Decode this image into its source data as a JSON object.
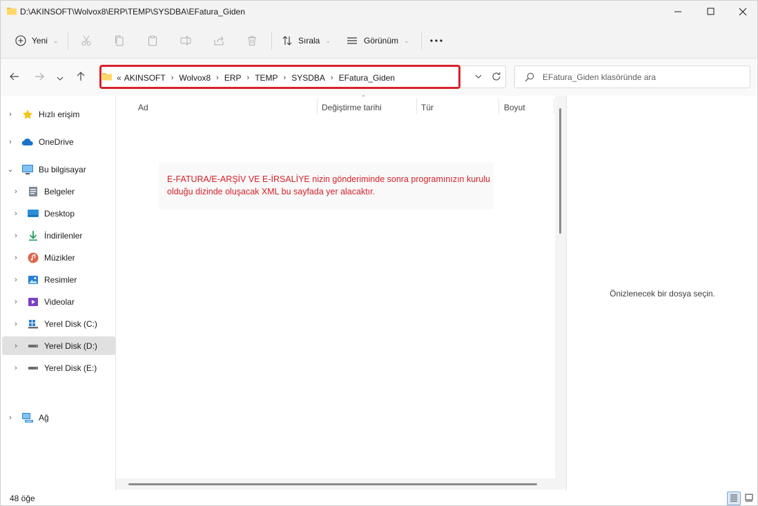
{
  "window": {
    "title": "D:\\AKINSOFT\\Wolvox8\\ERP\\TEMP\\SYSDBA\\EFatura_Giden",
    "controls": [
      "minimize",
      "maximize",
      "close"
    ]
  },
  "toolbar": {
    "new_label": "Yeni",
    "sort_label": "Sırala",
    "view_label": "Görünüm",
    "more_label": "···"
  },
  "address": {
    "overflow": "«",
    "crumbs": [
      "AKINSOFT",
      "Wolvox8",
      "ERP",
      "TEMP",
      "SYSDBA",
      "EFatura_Giden"
    ],
    "highlight_color": "#d9202a"
  },
  "search": {
    "placeholder": "EFatura_Giden klasöründe ara"
  },
  "nav": {
    "items": [
      {
        "label": "Hızlı erişim",
        "icon": "star-icon"
      },
      {
        "label": "OneDrive",
        "icon": "cloud-icon"
      },
      {
        "label": "Bu bilgisayar",
        "icon": "computer-icon"
      },
      {
        "label": "Belgeler",
        "icon": "documents-icon"
      },
      {
        "label": "Desktop",
        "icon": "desktop-icon"
      },
      {
        "label": "İndirilenler",
        "icon": "download-icon"
      },
      {
        "label": "Müzikler",
        "icon": "music-icon"
      },
      {
        "label": "Resimler",
        "icon": "pictures-icon"
      },
      {
        "label": "Videolar",
        "icon": "video-icon"
      },
      {
        "label": "Yerel Disk (C:)",
        "icon": "windows-drive-icon"
      },
      {
        "label": "Yerel Disk (D:)",
        "icon": "drive-icon",
        "selected": true
      },
      {
        "label": "Yerel Disk (E:)",
        "icon": "drive-icon"
      },
      {
        "label": "Ağ",
        "icon": "network-icon"
      }
    ]
  },
  "columns": {
    "name": "Ad",
    "date": "Değiştirme tarihi",
    "type": "Tür",
    "size": "Boyut"
  },
  "notice": {
    "text": "E-FATURA/E-ARŞİV VE E-İRSALİYE nizin gönderiminde sonra programınızın kurulu olduğu dizinde oluşacak XML bu sayfada yer alacaktır.",
    "color": "#d42128"
  },
  "preview": {
    "message": "Önizlenecek bir dosya seçin."
  },
  "status": {
    "item_count": "48 öğe"
  }
}
